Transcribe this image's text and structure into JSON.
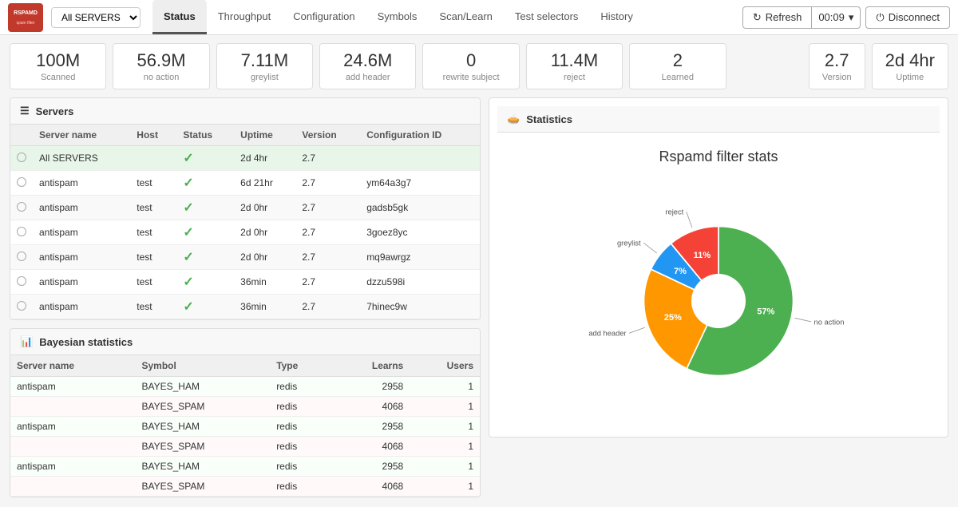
{
  "app": {
    "logo_text": "RSPAMD",
    "server_select": "All SERVERS"
  },
  "nav": {
    "tabs": [
      {
        "label": "Status",
        "active": true
      },
      {
        "label": "Throughput",
        "active": false
      },
      {
        "label": "Configuration",
        "active": false
      },
      {
        "label": "Symbols",
        "active": false
      },
      {
        "label": "Scan/Learn",
        "active": false
      },
      {
        "label": "Test selectors",
        "active": false
      },
      {
        "label": "History",
        "active": false
      }
    ],
    "refresh_label": "Refresh",
    "timer_label": "00:09",
    "disconnect_label": "Disconnect"
  },
  "stats": [
    {
      "value": "100M",
      "label": "Scanned"
    },
    {
      "value": "56.9M",
      "label": "no action"
    },
    {
      "value": "7.11M",
      "label": "greylist"
    },
    {
      "value": "24.6M",
      "label": "add header"
    },
    {
      "value": "0",
      "label": "rewrite subject"
    },
    {
      "value": "11.4M",
      "label": "reject"
    },
    {
      "value": "2",
      "label": "Learned"
    }
  ],
  "version": {
    "value": "2.7",
    "label": "Version"
  },
  "uptime": {
    "value": "2d 4hr",
    "label": "Uptime"
  },
  "servers_panel": {
    "title": "Servers",
    "columns": [
      "Server name",
      "Host",
      "Status",
      "Uptime",
      "Version",
      "Configuration ID"
    ],
    "rows": [
      {
        "name": "All SERVERS",
        "host": "",
        "status": "ok",
        "uptime": "2d 4hr",
        "version": "2.7",
        "config_id": "",
        "all": true
      },
      {
        "name": "antispam",
        "host": "test",
        "status": "ok",
        "uptime": "6d 21hr",
        "version": "2.7",
        "config_id": "ym64a3g7"
      },
      {
        "name": "antispam",
        "host": "test",
        "status": "ok",
        "uptime": "2d 0hr",
        "version": "2.7",
        "config_id": "gadsb5gk"
      },
      {
        "name": "antispam",
        "host": "test",
        "status": "ok",
        "uptime": "2d 0hr",
        "version": "2.7",
        "config_id": "3goez8yc"
      },
      {
        "name": "antispam",
        "host": "test",
        "status": "ok",
        "uptime": "2d 0hr",
        "version": "2.7",
        "config_id": "mq9awrgz"
      },
      {
        "name": "antispam",
        "host": "test",
        "status": "ok",
        "uptime": "36min",
        "version": "2.7",
        "config_id": "dzzu598i"
      },
      {
        "name": "antispam",
        "host": "test",
        "status": "ok",
        "uptime": "36min",
        "version": "2.7",
        "config_id": "7hinec9w"
      }
    ]
  },
  "bayesian_panel": {
    "title": "Bayesian statistics",
    "columns": [
      "Server name",
      "Symbol",
      "Type",
      "Learns",
      "Users"
    ],
    "rows": [
      {
        "server": "antispam",
        "symbol": "BAYES_HAM",
        "type": "redis",
        "learns": "2958",
        "users": "1",
        "ham": true
      },
      {
        "server": "",
        "symbol": "BAYES_SPAM",
        "type": "redis",
        "learns": "4068",
        "users": "1",
        "ham": false
      },
      {
        "server": "antispam",
        "symbol": "BAYES_HAM",
        "type": "redis",
        "learns": "2958",
        "users": "1",
        "ham": true
      },
      {
        "server": "",
        "symbol": "BAYES_SPAM",
        "type": "redis",
        "learns": "4068",
        "users": "1",
        "ham": false
      },
      {
        "server": "antispam",
        "symbol": "BAYES_HAM",
        "type": "redis",
        "learns": "2958",
        "users": "1",
        "ham": true
      },
      {
        "server": "",
        "symbol": "BAYES_SPAM",
        "type": "redis",
        "learns": "4068",
        "users": "1",
        "ham": false
      }
    ]
  },
  "chart": {
    "title": "Rspamd filter stats",
    "panel_title": "Statistics",
    "slices": [
      {
        "label": "no action",
        "percent": 57,
        "color": "#4caf50",
        "offset_angle": 0
      },
      {
        "label": "add header",
        "percent": 25,
        "color": "#ff9800",
        "offset_angle": 0
      },
      {
        "label": "greylist",
        "percent": 7,
        "color": "#2196f3",
        "offset_angle": 0
      },
      {
        "label": "reject",
        "percent": 11,
        "color": "#f44336",
        "offset_angle": 0
      }
    ]
  }
}
